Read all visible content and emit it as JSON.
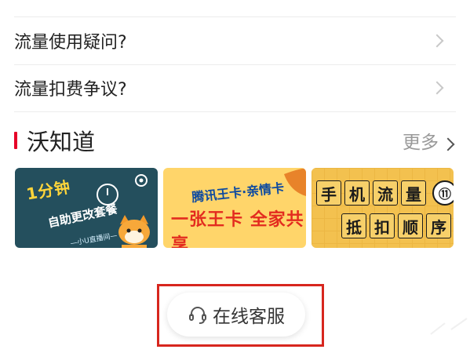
{
  "faq": {
    "items": [
      {
        "label": ""
      },
      {
        "label": "流量使用疑问?"
      },
      {
        "label": "流量扣费争议?"
      }
    ]
  },
  "section": {
    "title": "沃知道",
    "more_label": "更多",
    "accent_color": "#e60027"
  },
  "cards": [
    {
      "title_a": "1分钟",
      "title_b": "自助更改套餐",
      "note": "—小U直播间—",
      "icon": "clock-icon"
    },
    {
      "subtitle": "腾讯王卡·亲情卡",
      "title": "一张王卡 全家共享",
      "icon": "leaf-icon"
    },
    {
      "row1": [
        "手",
        "机",
        "流",
        "量"
      ],
      "badge": "⑪",
      "row2": [
        "抵",
        "扣",
        "顺",
        "序"
      ]
    }
  ],
  "service": {
    "label": "在线客服",
    "icon": "headset-icon",
    "highlight_color": "#d7261e"
  }
}
